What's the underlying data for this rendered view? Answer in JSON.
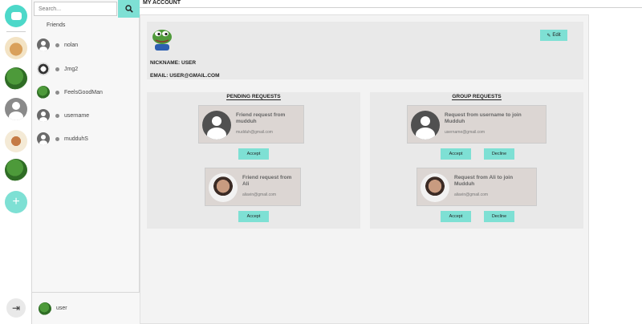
{
  "search": {
    "placeholder": "Search..."
  },
  "friends": {
    "title": "Friends",
    "items": [
      {
        "name": "nolan",
        "avatar": "user-icon"
      },
      {
        "name": "Jmg2",
        "avatar": "dog-avatar"
      },
      {
        "name": "FeelsGoodMan",
        "avatar": "frog-avatar"
      },
      {
        "name": "username",
        "avatar": "user-icon"
      },
      {
        "name": "mudduhS",
        "avatar": "user-icon"
      }
    ]
  },
  "current_user": {
    "name": "user",
    "avatar": "frog-avatar"
  },
  "page": {
    "title": "MY ACCOUNT"
  },
  "profile": {
    "edit_label": "Edit",
    "nickname": "NICKNAME: USER",
    "email": "EMAIL: USER@GMAIL.COM"
  },
  "pending": {
    "title": "PENDING REQUESTS",
    "requests": [
      {
        "title": "Friend request from mudduh",
        "email": "mudduh@gmail.com",
        "accept": "Accept"
      },
      {
        "title": "Friend request from Ali",
        "email": "aliavin@gmail.com",
        "accept": "Accept"
      }
    ]
  },
  "group": {
    "title": "GROUP REQUESTS",
    "requests": [
      {
        "title": "Request from username to join Mudduh",
        "email": "username@gmail.com",
        "accept": "Accept",
        "decline": "Decline"
      },
      {
        "title": "Request from Ali to join Mudduh",
        "email": "aliavin@gmail.com",
        "accept": "Accept",
        "decline": "Decline"
      }
    ]
  },
  "colors": {
    "accent": "#7ee0d4",
    "card": "#dcd6d3",
    "panel": "#e9e9e9"
  }
}
